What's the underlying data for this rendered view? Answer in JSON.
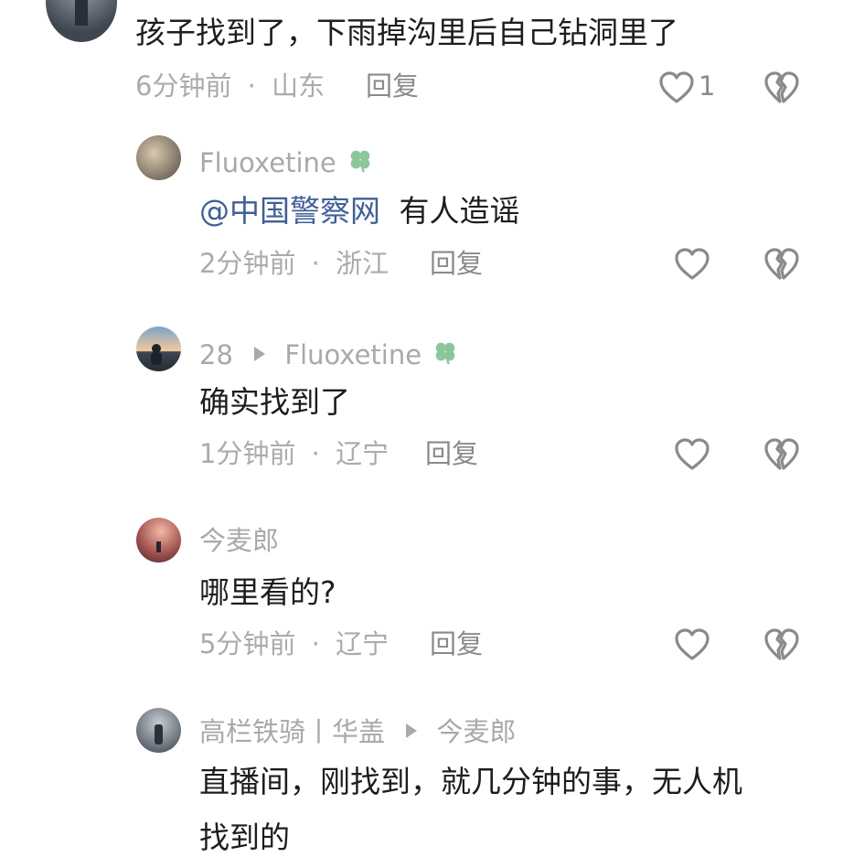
{
  "colors": {
    "mention": "#3f5f9a",
    "clover": "#8cc79a",
    "meta": "#ababab"
  },
  "comments": [
    {
      "name": "",
      "text": "孩子找到了，下雨掉沟里后自己钻洞里了",
      "time": "6分钟前",
      "location": "山东",
      "reply_label": "回复",
      "like_count": "1"
    },
    {
      "name": "Fluoxetine",
      "mention": "@中国警察网",
      "text": "有人造谣",
      "time": "2分钟前",
      "location": "浙江",
      "reply_label": "回复"
    },
    {
      "name": "28",
      "reply_to": "Fluoxetine",
      "text": "确实找到了",
      "time": "1分钟前",
      "location": "辽宁",
      "reply_label": "回复"
    },
    {
      "name": "今麦郎",
      "text": "哪里看的?",
      "time": "5分钟前",
      "location": "辽宁",
      "reply_label": "回复"
    },
    {
      "name": "高栏铁骑丨华盖",
      "reply_to": "今麦郎",
      "text_line1": "直播间，刚找到，就几分钟的事，无人机",
      "text_line2": "找到的"
    }
  ],
  "separator": "·",
  "icons": {
    "like": "heart-outline-icon",
    "dislike": "broken-heart-icon",
    "author_badge": "clover-icon"
  }
}
